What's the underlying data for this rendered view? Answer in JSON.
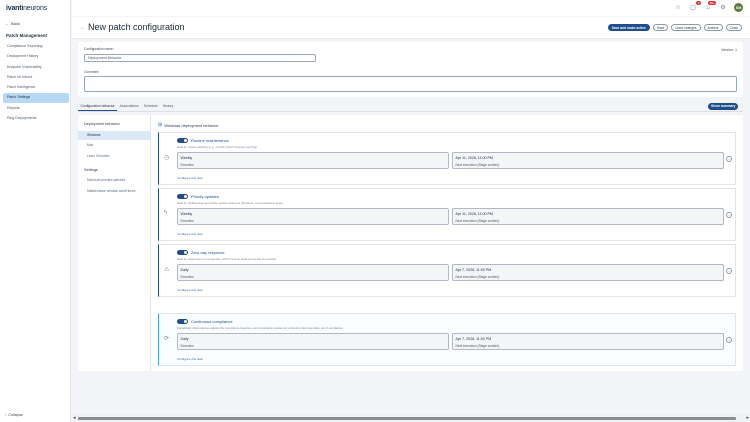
{
  "brand": {
    "logo_bold": "ivanti",
    "logo_light": "neurons"
  },
  "sidebar": {
    "back_label": "Back",
    "section_title": "Patch Management",
    "items": [
      {
        "label": "Compliance Reporting"
      },
      {
        "label": "Deployment History"
      },
      {
        "label": "Endpoint Vulnerability"
      },
      {
        "label": "Patch for Intune"
      },
      {
        "label": "Patch Intelligence"
      },
      {
        "label": "Patch Settings"
      },
      {
        "label": "Reports"
      },
      {
        "label": "Ring Deployments"
      }
    ],
    "active_index": 5,
    "collapse_label": "Collapse"
  },
  "topbar": {
    "notif_badge": "9",
    "alerts_badge": "99+",
    "avatar_initials": "SM"
  },
  "header": {
    "title": "New patch configuration"
  },
  "actions": {
    "save_activate": "Save and make active",
    "save": "Save",
    "undo": "Undo changes",
    "archive": "Archive",
    "close": "Close"
  },
  "form": {
    "name_label": "Configuration name:",
    "name_value": "Deployment Behavior",
    "comment_label": "Comment:",
    "comment_value": "",
    "version": "Version: 1"
  },
  "tabs": [
    {
      "label": "Configuration behavior"
    },
    {
      "label": "Associations"
    },
    {
      "label": "Schedule"
    },
    {
      "label": "History"
    }
  ],
  "show_summary": "Show summary",
  "leftnav": {
    "deployment_title": "Deployment behavior",
    "deployment_items": [
      {
        "label": "Windows"
      },
      {
        "label": "Mac"
      },
      {
        "label": "Linux Overview"
      }
    ],
    "settings_title": "Settings",
    "settings_items": [
      {
        "label": "Microsoft preview patches"
      },
      {
        "label": "Maintenance window cutoff times"
      }
    ]
  },
  "windows_title": "Windows deployment behavior",
  "panels": [
    {
      "title": "Routine maintenance",
      "desc": "Ideal for routine patching (e.g., monthly Patch Tuesday patching)",
      "freq": "Weekly",
      "freq_sub": "Executes",
      "date": "Apr 11, 2028, 11:00 PM",
      "date_sub": "Next execution (Stage content)",
      "configure": "Configure this task",
      "icon": "clock-icon"
    },
    {
      "title": "Priority updates",
      "desc": "Ideal for updates that need faster update cadences (browsers, communications apps)",
      "freq": "Weekly",
      "freq_sub": "Executes",
      "date": "Apr 11, 2028, 11:00 PM",
      "date_sub": "Next execution (Stage content)",
      "configure": "Configure this task",
      "icon": "bolt-icon"
    },
    {
      "title": "Zero-day response",
      "desc": "Ideal for responses to emergencies, which must be deployed as fast as possible",
      "freq": "Daily",
      "freq_sub": "Executes",
      "date": "Apr 7, 2028, 11:00 PM",
      "date_sub": "Next execution (Stage content)",
      "configure": "Configure this task",
      "icon": "warning-icon"
    },
    {
      "title": "Continuous compliance",
      "desc": "Periodically check devices against the Compliance baseline, and immediately update any endpoints that have fallen out of compliance",
      "freq": "Daily",
      "freq_sub": "Executes",
      "date": "Apr 7, 2028, 11:00 PM",
      "date_sub": "Next execution (Stage content)",
      "configure": "Configure this task",
      "icon": "sync-icon"
    }
  ]
}
